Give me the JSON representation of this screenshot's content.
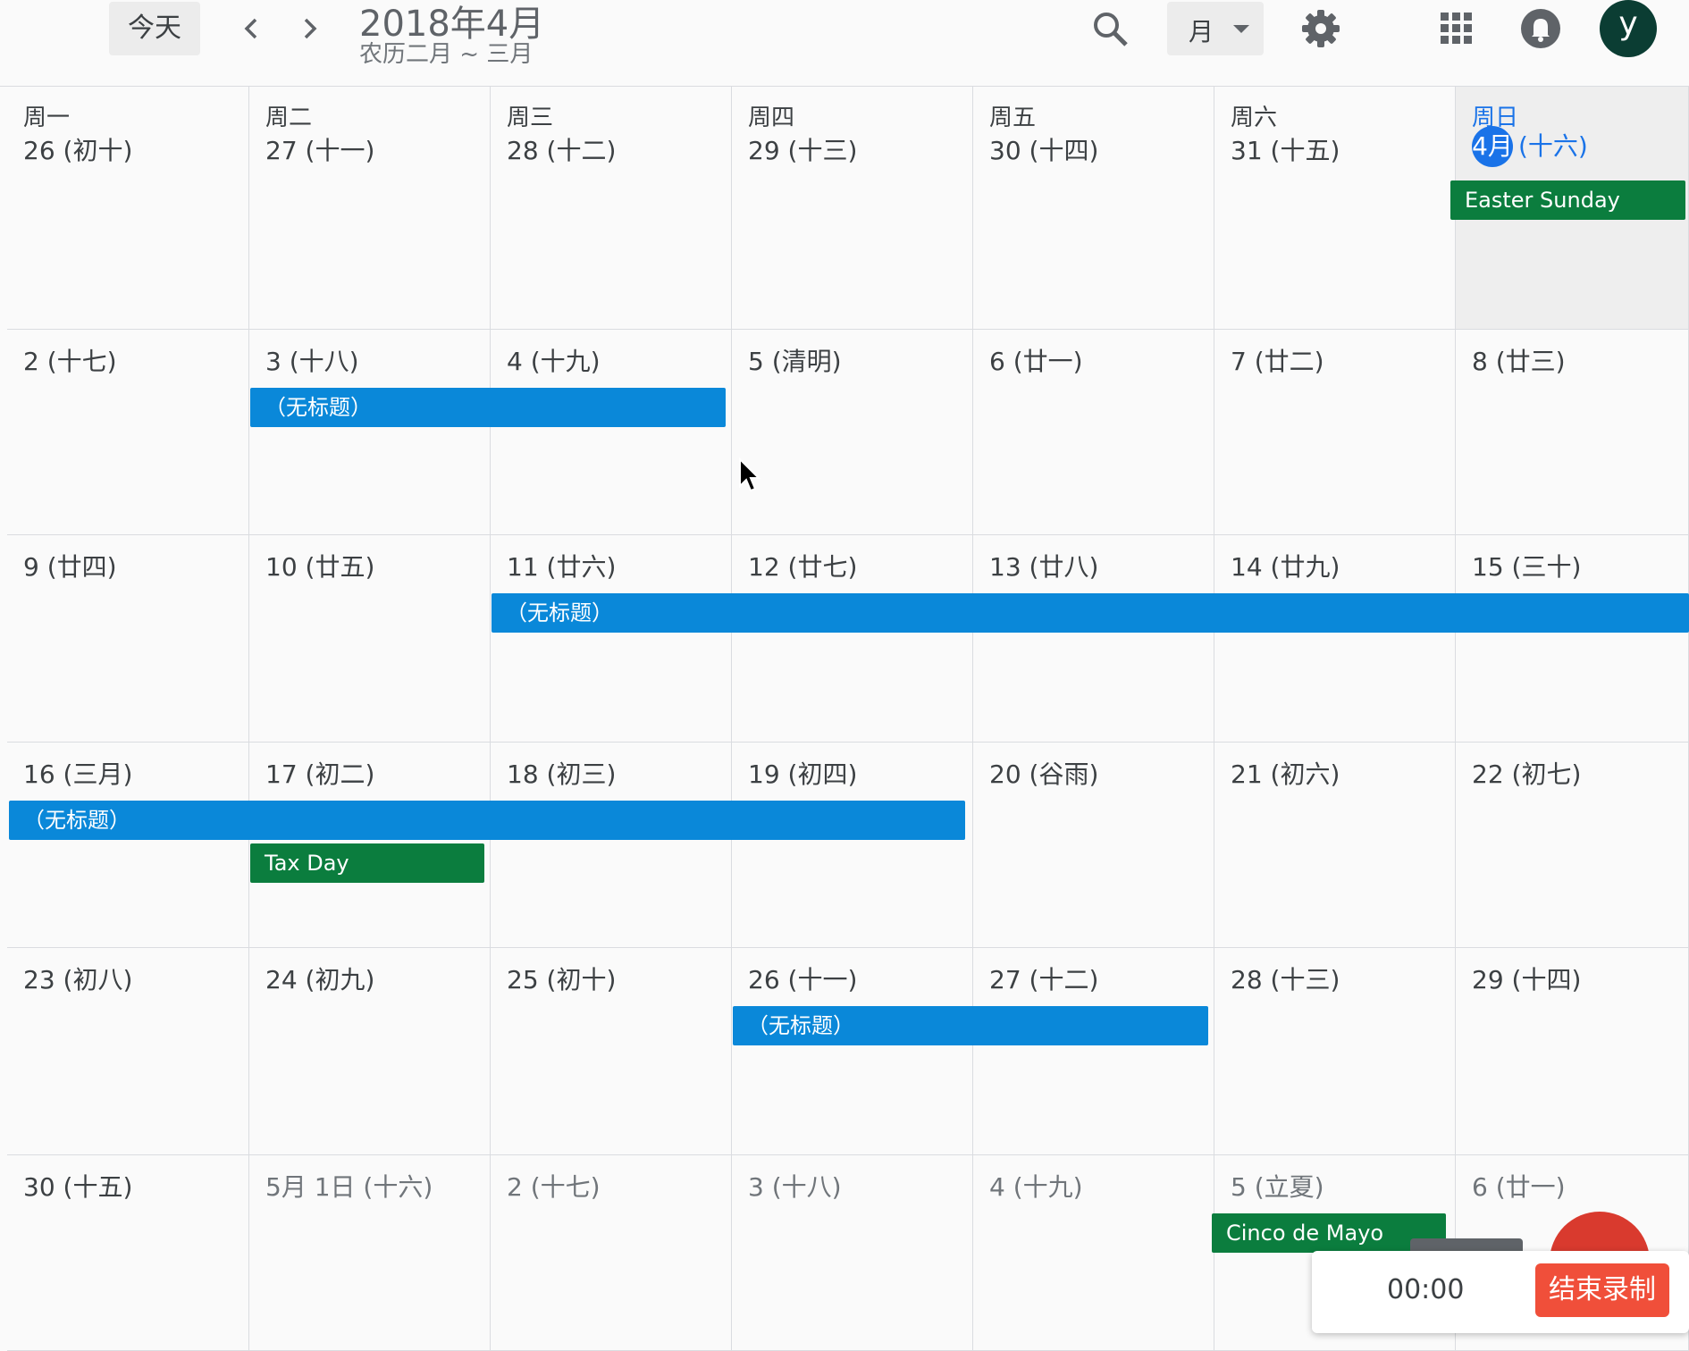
{
  "header": {
    "today_label": "今天",
    "title": "2018年4月",
    "subtitle": "农历二月 ~ 三月",
    "view_label": "月",
    "avatar_initial": "y",
    "icons": [
      "search-icon",
      "gear-icon",
      "apps-icon",
      "bell-icon"
    ]
  },
  "weekdays": [
    "周一",
    "周二",
    "周三",
    "周四",
    "周五",
    "周六",
    "周日"
  ],
  "weeks": [
    [
      "26 (初十)",
      "27 (十一)",
      "28 (十二)",
      "29 (十三)",
      "30 (十四)",
      "31 (十五)",
      "(十六)"
    ],
    [
      "2 (十七)",
      "3 (十八)",
      "4 (十九)",
      "5 (清明)",
      "6 (廿一)",
      "7 (廿二)",
      "8 (廿三)"
    ],
    [
      "9 (廿四)",
      "10 (廿五)",
      "11 (廿六)",
      "12 (廿七)",
      "13 (廿八)",
      "14 (廿九)",
      "15 (三十)"
    ],
    [
      "16 (三月)",
      "17 (初二)",
      "18 (初三)",
      "19 (初四)",
      "20 (谷雨)",
      "21 (初六)",
      "22 (初七)"
    ],
    [
      "23 (初八)",
      "24 (初九)",
      "25 (初十)",
      "26 (十一)",
      "27 (十二)",
      "28 (十三)",
      "29 (十四)"
    ],
    [
      "30 (十五)",
      "5月 1日 (十六)",
      "2 (十七)",
      "3 (十八)",
      "4 (十九)",
      "5 (立夏)",
      "6 (廿一)"
    ]
  ],
  "today_badge": "4月",
  "events": {
    "easter": "Easter Sunday",
    "untitled_1": "（无标题）",
    "untitled_2": "（无标题）",
    "untitled_3": "（无标题）",
    "tax_day": "Tax Day",
    "untitled_4": "（无标题）",
    "cinco": "Cinco de Mayo"
  },
  "colors": {
    "event_blue": "#0a88d9",
    "event_green": "#0b7d3e",
    "today_blue": "#1a73e8",
    "record_red": "#f04f3a"
  },
  "recorder": {
    "time": "00:00",
    "stop_label": "结束录制"
  }
}
